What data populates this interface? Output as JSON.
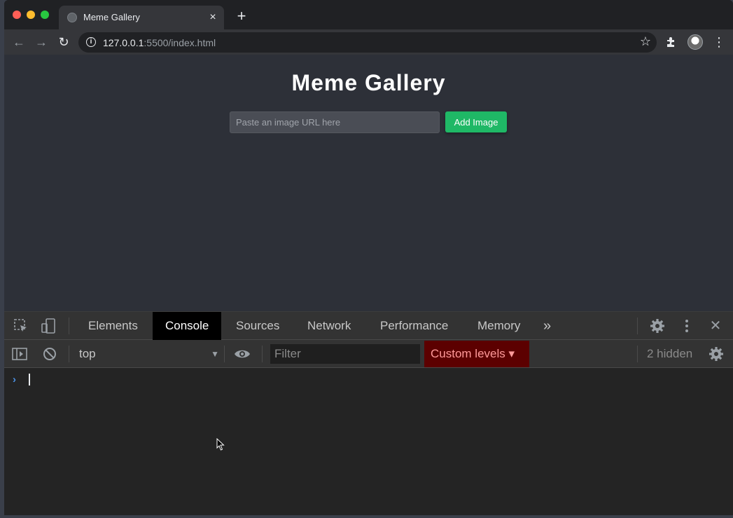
{
  "browser": {
    "tab_title": "Meme Gallery",
    "tab_close_icon": "×",
    "new_tab_icon": "+",
    "url_host": "127.0.0.1",
    "url_path": ":5500/index.html",
    "icons": {
      "back": "←",
      "forward": "→",
      "reload": "↻",
      "info": "i",
      "star": "☆",
      "menu": "⋮"
    }
  },
  "page": {
    "title": "Meme Gallery",
    "input_placeholder": "Paste an image URL here",
    "add_button": "Add Image",
    "accent_color": "#1fb866"
  },
  "devtools": {
    "tabs": [
      {
        "label": "Elements",
        "active": false
      },
      {
        "label": "Console",
        "active": true
      },
      {
        "label": "Sources",
        "active": false
      },
      {
        "label": "Network",
        "active": false
      },
      {
        "label": "Performance",
        "active": false
      },
      {
        "label": "Memory",
        "active": false
      }
    ],
    "more_tabs_icon": "»",
    "close_icon": "✕",
    "context": "top",
    "filter_placeholder": "Filter",
    "levels_label": "Custom levels ▾",
    "hidden_count": "2 hidden",
    "prompt_symbol": "›"
  }
}
